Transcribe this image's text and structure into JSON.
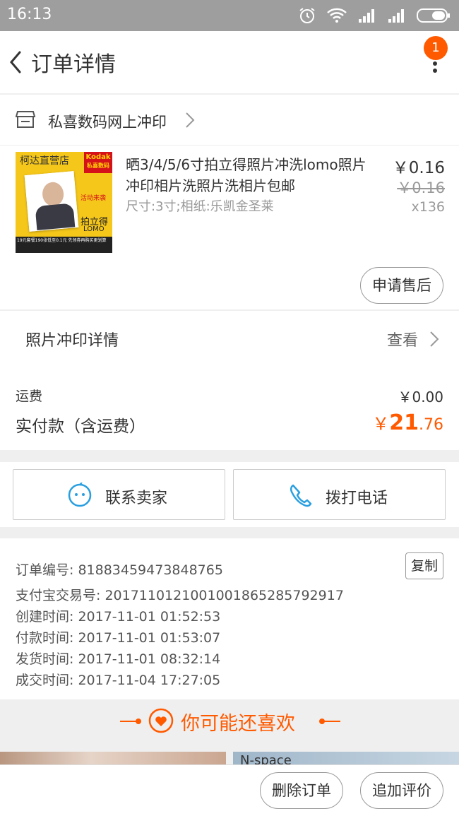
{
  "status_bar": {
    "time": "16:13"
  },
  "nav": {
    "title": "订单详情",
    "badge_count": "1"
  },
  "store": {
    "name": "私喜数码网上冲印"
  },
  "item": {
    "title": "晒3/4/5/6寸拍立得照片冲洗lomo照片冲印相片洗照片洗相片包邮",
    "spec": "尺寸:3寸;相纸:乐凯金圣莱",
    "price": "￥0.16",
    "original_price": "￥0.16",
    "quantity": "x136",
    "after_sale_label": "申请售后",
    "thumb": {
      "store_tag": "柯达直营店",
      "brand": "Kodak",
      "brand_sub": "私喜数码",
      "promo": "活动来袭",
      "lomo_line1": "拍立得",
      "lomo_line2": "LOMO",
      "footer": "19元套餐190张低至0.1元 先领券再购买更划算"
    }
  },
  "photo_detail": {
    "label": "照片冲印详情",
    "action": "查看"
  },
  "fees": {
    "shipping_label": "运费",
    "shipping_value": "￥0.00",
    "paid_label": "实付款（含运费）",
    "paid_currency": "￥",
    "paid_integer": "21",
    "paid_decimal": ".76"
  },
  "actions": {
    "contact_seller": "联系卖家",
    "call": "拨打电话"
  },
  "order_info": {
    "order_no": "订单编号: 81883459473848765",
    "copy_label": "复制",
    "alipay_no": "支付宝交易号: 2017110121001001865285792917",
    "created": "创建时间: 2017-11-01 01:52:53",
    "paid": "付款时间: 2017-11-01 01:53:07",
    "shipped": "发货时间: 2017-11-01 08:32:14",
    "completed": "成交时间: 2017-11-04 17:27:05"
  },
  "recommend": {
    "title": "你可能还喜欢",
    "img2_text": "N-space"
  },
  "bottom": {
    "delete_order": "删除订单",
    "add_review": "追加评价"
  },
  "colors": {
    "accent": "#ff5a00",
    "status_bar": "#9e9e9e",
    "icon_blue": "#2a9fe0"
  }
}
